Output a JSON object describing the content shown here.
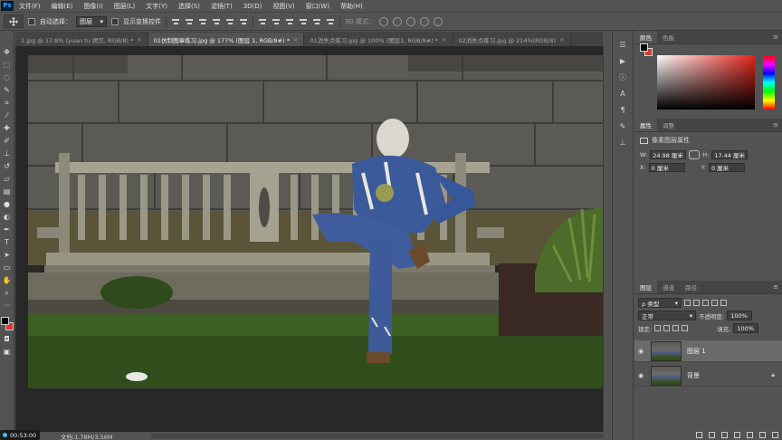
{
  "app": {
    "logo": "Ps"
  },
  "menu": [
    "文件(F)",
    "编辑(E)",
    "图像(I)",
    "图层(L)",
    "文字(Y)",
    "选择(S)",
    "滤镜(T)",
    "3D(D)",
    "视图(V)",
    "窗口(W)",
    "帮助(H)"
  ],
  "options": {
    "auto_select_label": "自动选择：",
    "auto_select_value": "图层",
    "show_transform_label": "显示变换控件",
    "mode_3d_label": "3D 模式："
  },
  "tabs": [
    {
      "label": "1.jpg @ 17.8% (yuan tu 拷贝, RGB/8) *",
      "active": false
    },
    {
      "label": "01仿制图章练习.jpg @ 177% (图层 1, RGB/8#) *",
      "active": true
    },
    {
      "label": "01消失点练习.jpg @ 100% (图层1, RGB/8#) *",
      "active": false
    },
    {
      "label": "02消失点练习.jpg @ 214%(RGB/8)",
      "active": false
    }
  ],
  "status": {
    "doc_info": "文档:1.78M/3.56M",
    "timer": "00:53:00"
  },
  "color_panel": {
    "tabs": [
      "颜色",
      "色板"
    ],
    "fg": "#000000",
    "bg": "#d8382b"
  },
  "properties": {
    "tabs": [
      "属性",
      "调整"
    ],
    "title": "像素图层属性",
    "w_label": "W:",
    "w_value": "24.98 厘米",
    "h_label": "H:",
    "h_value": "17.44 厘米",
    "x_label": "X:",
    "x_value": "0 厘米",
    "y_label": "Y:",
    "y_value": "0 厘米"
  },
  "layers": {
    "tabs": [
      "图层",
      "通道",
      "路径"
    ],
    "filter_label": "ρ 类型",
    "blend_mode": "正常",
    "opacity_label": "不透明度:",
    "opacity_value": "100%",
    "lock_label": "锁定:",
    "fill_label": "填充:",
    "fill_value": "100%",
    "items": [
      {
        "name": "图层 1",
        "active": true
      },
      {
        "name": "背景",
        "active": false
      }
    ]
  }
}
